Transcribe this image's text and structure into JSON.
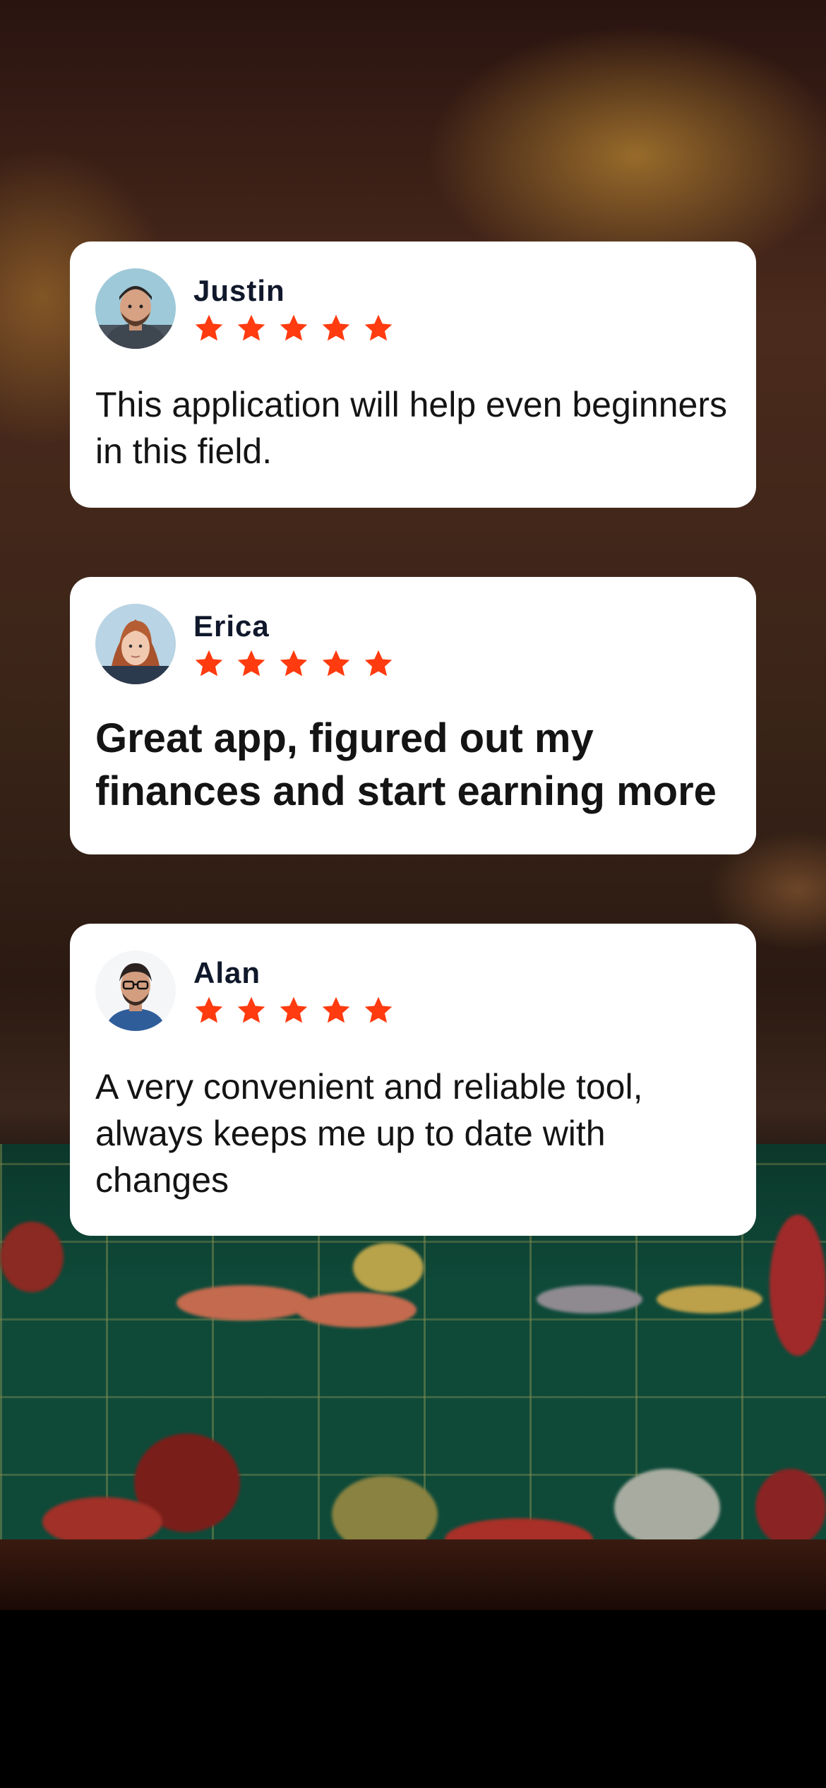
{
  "reviews": [
    {
      "name": "Justin",
      "rating": 5,
      "text": "This application will help even beginners in this field.",
      "style": "regular",
      "avatar_icon": "avatar-man-beanie"
    },
    {
      "name": "Erica",
      "rating": 5,
      "text": "Great app, figured out my finances and start earning more",
      "style": "bold",
      "avatar_icon": "avatar-woman-red-hair"
    },
    {
      "name": "Alan",
      "rating": 5,
      "text": "A very convenient and reliable tool, always keeps me up to date with changes",
      "style": "regular",
      "avatar_icon": "avatar-man-glasses"
    }
  ],
  "colors": {
    "star": "#ff3b0f",
    "card": "#ffffff",
    "name": "#10182b",
    "text": "#141414"
  }
}
